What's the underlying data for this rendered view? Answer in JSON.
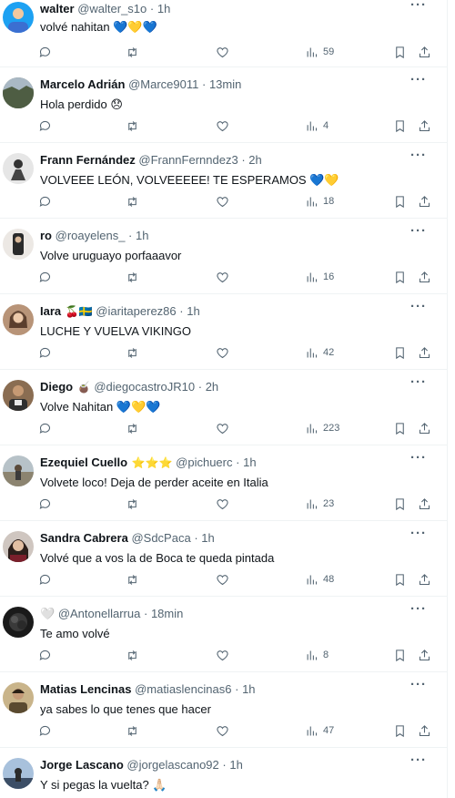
{
  "replies": [
    {
      "name": "walter",
      "badge": "",
      "handle": "@walter_s1o",
      "time": "1h",
      "text": "volvé nahitan 💙💛💙",
      "views": "59",
      "avatar_color": "#1da1f2"
    },
    {
      "name": "Marcelo Adrián",
      "badge": "",
      "handle": "@Marce9011",
      "time": "13min",
      "text": "Hola perdido 😞",
      "views": "4",
      "avatar_color": "#5b6b5a"
    },
    {
      "name": "Frann Fernández",
      "badge": "",
      "handle": "@FrannFernndez3",
      "time": "2h",
      "text": "VOLVEEE LEÓN, VOLVEEEEE! TE ESPERAMOS 💙💛",
      "views": "18",
      "avatar_color": "#c9c9c9"
    },
    {
      "name": "ro",
      "badge": "",
      "handle": "@roayelens_",
      "time": "1h",
      "text": "Volve uruguayo porfaaavor",
      "views": "16",
      "avatar_color": "#e8e4e0"
    },
    {
      "name": "Iara",
      "badge": "🍒🇸🇪",
      "handle": "@iaritaperez86",
      "time": "1h",
      "text": "LUCHE Y VUELVA VIKINGO",
      "views": "42",
      "avatar_color": "#7a5a45"
    },
    {
      "name": "Diego",
      "badge": "🧉",
      "handle": "@diegocastroJR10",
      "time": "2h",
      "text": "Volve Nahitan 💙💛💙",
      "views": "223",
      "avatar_color": "#8a6d52"
    },
    {
      "name": "Ezequiel Cuello",
      "badge": "⭐⭐⭐",
      "handle": "@pichuerc",
      "time": "1h",
      "text": "Volvete loco! Deja de perder aceite en Italia",
      "views": "23",
      "avatar_color": "#9aa8a0"
    },
    {
      "name": "Sandra Cabrera",
      "badge": "",
      "handle": "@SdcPaca",
      "time": "1h",
      "text": "Volvé que a vos la de Boca te queda pintada",
      "views": "48",
      "avatar_color": "#4a3a34"
    },
    {
      "name": "🤍",
      "badge": "",
      "handle": "@Antonellarrua",
      "time": "18min",
      "text": "Te amo volvé",
      "views": "8",
      "avatar_color": "#1a1a1a"
    },
    {
      "name": "Matias Lencinas",
      "badge": "",
      "handle": "@matiaslencinas6",
      "time": "1h",
      "text": "ya sabes lo que tenes que hacer",
      "views": "47",
      "avatar_color": "#6b5a40"
    },
    {
      "name": "Jorge Lascano",
      "badge": "",
      "handle": "@jorgelascano92",
      "time": "1h",
      "text": "Y si pegas la vuelta? 🙏🏻",
      "views": "",
      "avatar_color": "#5a6e8a"
    }
  ],
  "colors": {
    "text": "#0f1419",
    "secondary": "#536471",
    "divider": "#eff3f4"
  },
  "icons": {
    "reply": "reply-icon",
    "retweet": "retweet-icon",
    "like": "heart-icon",
    "views": "views-icon",
    "bookmark": "bookmark-icon",
    "share": "share-icon",
    "more": "more-icon"
  }
}
